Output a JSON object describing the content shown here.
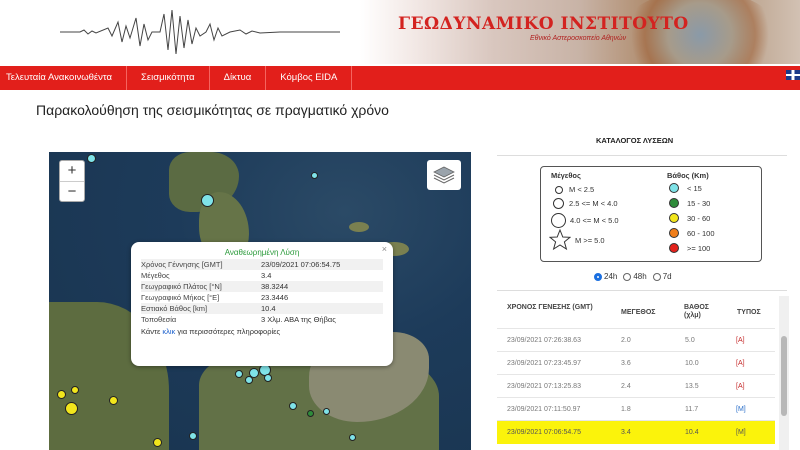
{
  "header": {
    "institute_title": "ΓΕΩΔΥΝΑΜΙΚΟ ΙΝΣΤΙΤΟΥΤΟ",
    "institute_subtitle": "Εθνικό Αστεροσκοπείο Αθηνών"
  },
  "nav": {
    "items": [
      {
        "label": "Τελευταία Ανακοινωθέντα"
      },
      {
        "label": "Σεισμικότητα"
      },
      {
        "label": "Δίκτυα"
      },
      {
        "label": "Κόμβος EIDA"
      }
    ],
    "flag_icon": "uk-flag-icon"
  },
  "page": {
    "title": "Παρακολούθηση της σεισμικότητας σε πραγματικό χρόνο"
  },
  "map": {
    "zoom_in": "+",
    "zoom_out": "−",
    "layers_icon": "layers-icon",
    "popup": {
      "title": "Αναθεωρημένη Λύση",
      "close": "×",
      "rows": [
        {
          "key": "Χρόνος Γέννησης [GMT]",
          "value": "23/09/2021 07:06:54.75"
        },
        {
          "key": "Μέγεθος",
          "value": "3.4"
        },
        {
          "key": "Γεωγραφικό Πλάτος [°N]",
          "value": "38.3244"
        },
        {
          "key": "Γεωγραφικό Μήκος [°E]",
          "value": "23.3446"
        },
        {
          "key": "Εστιακό Βάθος [km]",
          "value": "10.4"
        },
        {
          "key": "Τοποθεσία",
          "value": "3 Χλμ. ΑΒΑ της Θήβας"
        }
      ],
      "footer_prefix": "Κάντε ",
      "footer_link": "κλικ",
      "footer_suffix": " για περισσότερες πληροφορίες"
    }
  },
  "catalog": {
    "title": "ΚΑΤΑΛΟΓΟΣ ΛΥΣΕΩΝ",
    "legend": {
      "magnitude_header": "Μέγεθος",
      "depth_header": "Βάθος (Km)",
      "magnitude_items": [
        "M < 2.5",
        "2.5 <= M < 4.0",
        "4.0 <= M < 5.0",
        "M >= 5.0"
      ],
      "depth_items": [
        {
          "label": "< 15",
          "color": "#7fe3e8"
        },
        {
          "label": "15 - 30",
          "color": "#2e8b3a"
        },
        {
          "label": "30 - 60",
          "color": "#f2e61c"
        },
        {
          "label": "60 - 100",
          "color": "#f07e1a"
        },
        {
          "label": ">= 100",
          "color": "#e3221c"
        }
      ]
    },
    "time_filter": {
      "options": [
        "24h",
        "48h",
        "7d"
      ],
      "selected": "24h"
    },
    "table": {
      "headers": {
        "time": "ΧΡΟΝΟΣ ΓΕΝΕΣΗΣ (GMT)",
        "magnitude": "ΜΕΓΕΘΟΣ",
        "depth": "ΒΑΘΟΣ (χλμ)",
        "type": "ΤΥΠΟΣ"
      },
      "rows": [
        {
          "time": "23/09/2021 07:26:38.63",
          "magnitude": "2.0",
          "depth": "5.0",
          "type": "[A]"
        },
        {
          "time": "23/09/2021 07:23:45.97",
          "magnitude": "3.6",
          "depth": "10.0",
          "type": "[A]"
        },
        {
          "time": "23/09/2021 07:13:25.83",
          "magnitude": "2.4",
          "depth": "13.5",
          "type": "[A]"
        },
        {
          "time": "23/09/2021 07:11:50.97",
          "magnitude": "1.8",
          "depth": "11.7",
          "type": "[M]"
        },
        {
          "time": "23/09/2021 07:06:54.75",
          "magnitude": "3.4",
          "depth": "10.4",
          "type": "[M]",
          "selected": true
        }
      ]
    }
  },
  "colors": {
    "nav_red": "#e21f1b",
    "title_red": "#d32320",
    "highlight_yellow": "#fbf30b",
    "popup_green": "#2a9a3a"
  }
}
